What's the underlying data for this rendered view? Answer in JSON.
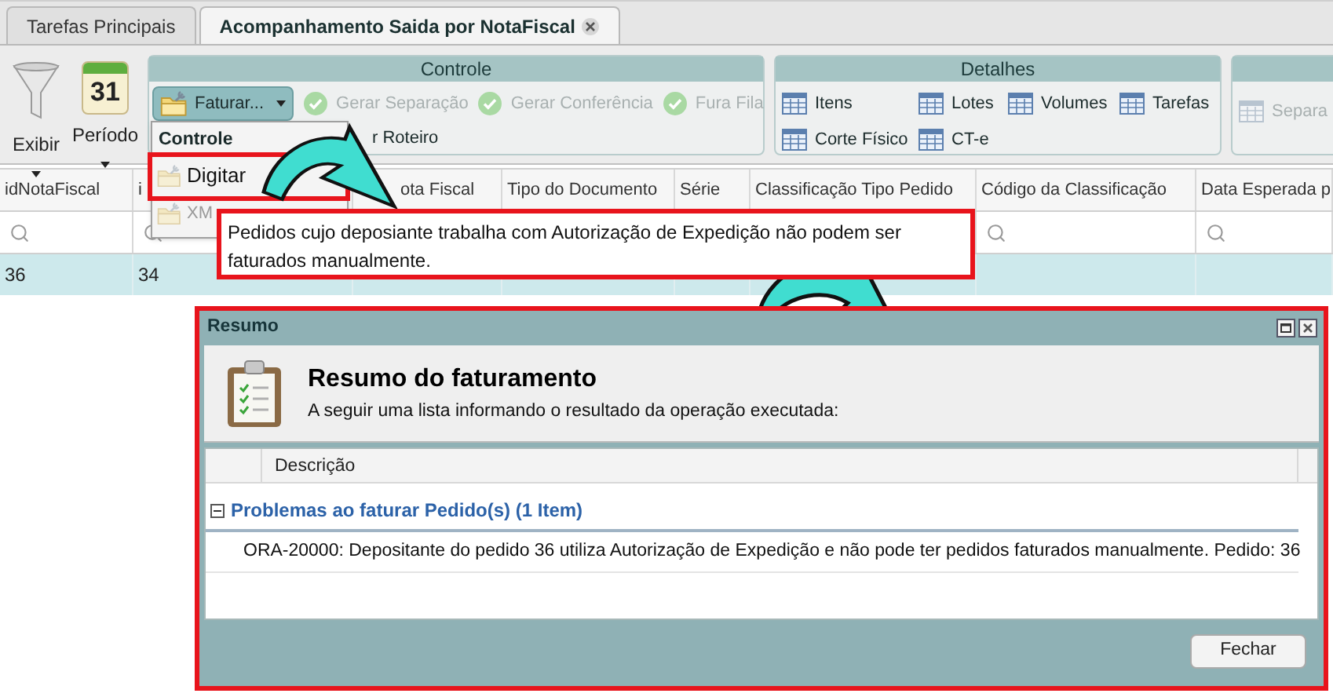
{
  "tabs": [
    {
      "label": "Tarefas Principais",
      "selected": false,
      "closable": false
    },
    {
      "label": "Acompanhamento Saida por NotaFiscal",
      "selected": true,
      "closable": true
    }
  ],
  "toolbar": {
    "view_buttons": [
      {
        "label": "Exibir",
        "kind": "filter"
      },
      {
        "label": "Período",
        "kind": "calendar",
        "icon_text": "31"
      }
    ],
    "groups": [
      {
        "title": "Controle",
        "kind": "controle",
        "buttons": [
          {
            "label": "Faturar...",
            "kind": "menu",
            "disabled": false,
            "selected": true
          },
          {
            "label": "Gerar Separação",
            "kind": "check",
            "disabled": true
          },
          {
            "label": "Gerar Conferência",
            "kind": "check",
            "disabled": true
          },
          {
            "label": "Fura Fila",
            "kind": "check",
            "disabled": true
          },
          {
            "label": "r Roteiro",
            "kind": "plain",
            "disabled": false
          }
        ]
      },
      {
        "title": "Detalhes",
        "kind": "detalhes",
        "buttons": [
          {
            "label": "Itens",
            "kind": "table",
            "disabled": false
          },
          {
            "label": "Lotes",
            "kind": "table",
            "disabled": false
          },
          {
            "label": "Volumes",
            "kind": "table",
            "disabled": false
          },
          {
            "label": "Tarefas",
            "kind": "table",
            "disabled": false
          },
          {
            "label": "Corte Físico",
            "kind": "table",
            "disabled": false
          },
          {
            "label": "CT-e",
            "kind": "table",
            "disabled": false
          }
        ]
      },
      {
        "kind": "other",
        "buttons": [
          {
            "label": "Separa",
            "kind": "table",
            "disabled": true
          }
        ]
      }
    ]
  },
  "grid": {
    "columns": [
      "idNotaFiscal",
      "i",
      "ota Fiscal",
      "Tipo do Documento",
      "Série",
      "Classificação Tipo Pedido",
      "Código da Classificação",
      "Data Esperada p"
    ],
    "rows": [
      {
        "cells": [
          "36",
          "34"
        ],
        "selected": true
      }
    ]
  },
  "menu": {
    "title": "Controle",
    "items": [
      {
        "label": "Digitar",
        "disabled": false
      },
      {
        "label": "XM",
        "disabled": true
      }
    ]
  },
  "callout": {
    "text": "Pedidos cujo deposiante trabalha com Autorização de Expedição não podem ser faturados manualmente."
  },
  "dialog": {
    "title": "Resumo",
    "heading": "Resumo do faturamento",
    "subtitle": "A seguir uma lista informando o resultado da operação executada:",
    "column": "Descrição",
    "groups": [
      {
        "title": "Problemas ao faturar Pedido(s) (1 Item)",
        "expanded": true,
        "items": [
          {
            "kind": "error",
            "text": "ORA-20000: Depositante do pedido 36 utiliza Autorização de Expedição e não pode ter pedidos faturados manualmente. Pedido: 36"
          }
        ]
      }
    ],
    "buttons": [
      "Fechar"
    ]
  }
}
